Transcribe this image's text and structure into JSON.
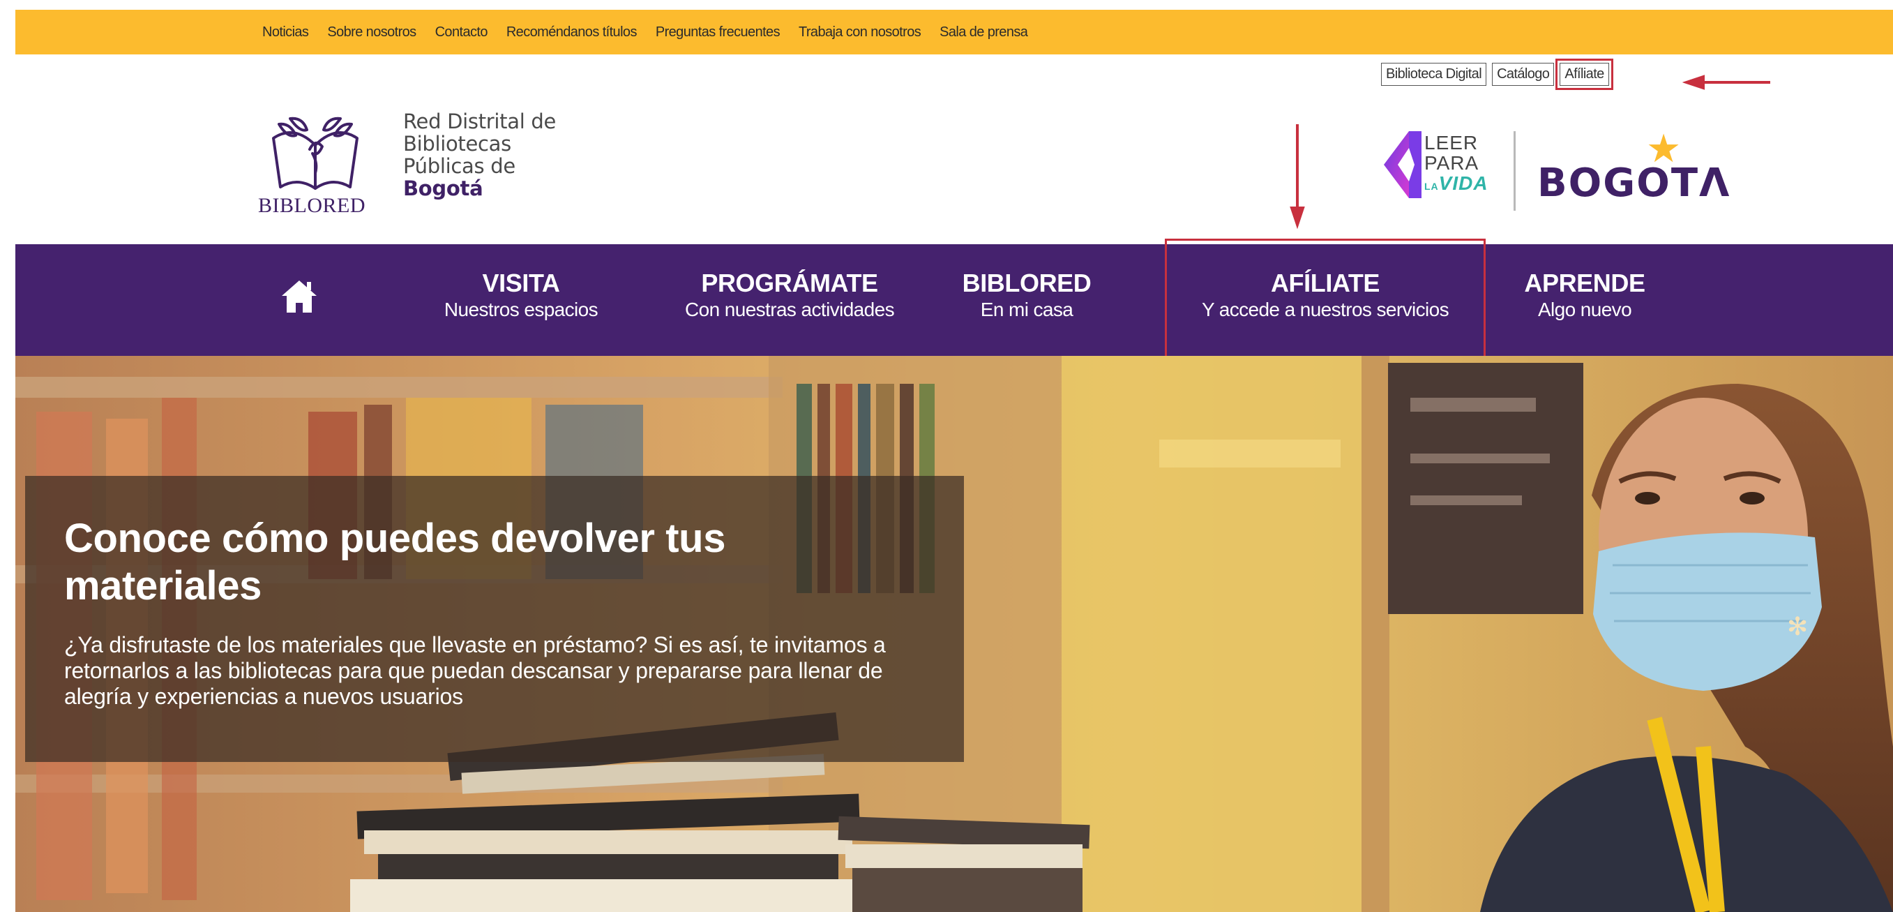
{
  "topbar": {
    "links": [
      "Noticias",
      "Sobre nosotros",
      "Contacto",
      "Recoméndanos títulos",
      "Preguntas frecuentes",
      "Trabaja con nosotros",
      "Sala de prensa"
    ]
  },
  "header": {
    "logo_word": "BIBLORED",
    "org_lines": [
      "Red Distrital de",
      "Bibliotecas",
      "Públicas de"
    ],
    "org_city": "Bogotá",
    "utility_buttons": [
      "Biblioteca Digital",
      "Catálogo",
      "Afíliate"
    ],
    "leer": [
      "LEER",
      "PARA"
    ],
    "leer_la": "LA",
    "leer_vida": "VIDA",
    "bogota": "BOGOTΛ"
  },
  "nav": {
    "items": [
      {
        "title": "VISITA",
        "subtitle": "Nuestros espacios"
      },
      {
        "title": "PROGRÁMATE",
        "subtitle": "Con nuestras actividades"
      },
      {
        "title": "BIBLORED",
        "subtitle": "En mi casa"
      },
      {
        "title": "AFÍLIATE",
        "subtitle": "Y accede a nuestros servicios"
      },
      {
        "title": "APRENDE",
        "subtitle": "Algo nuevo"
      }
    ]
  },
  "hero": {
    "title": "Conoce cómo puedes devolver tus materiales",
    "text": "¿Ya disfrutaste de los materiales que llevaste en préstamo? Si es así, te invitamos a retornarlos a las bibliotecas para que puedan descansar y prepararse para llenar de alegría y experiencias a nuevos usuarios"
  },
  "colors": {
    "topbar": "#fcbb2e",
    "nav": "#45226e",
    "brand_purple": "#3f2166",
    "annotation_red": "#c8303e"
  }
}
